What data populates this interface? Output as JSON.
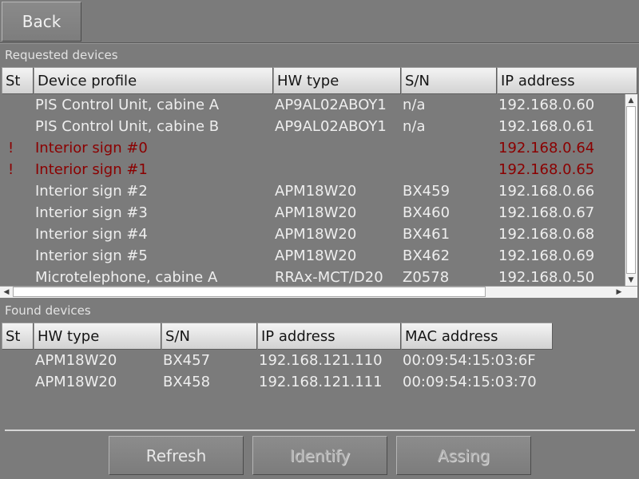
{
  "back_label": "Back",
  "requested": {
    "label": "Requested devices",
    "columns": [
      "St",
      "Device profile",
      "HW type",
      "S/N",
      "IP address"
    ],
    "rows": [
      {
        "st": "",
        "profile": "PIS Control Unit, cabine A",
        "hw": "AP9AL02ABOY1",
        "sn": "n/a",
        "ip": "192.168.0.60"
      },
      {
        "st": "",
        "profile": "PIS Control Unit, cabine B",
        "hw": "AP9AL02ABOY1",
        "sn": "n/a",
        "ip": "192.168.0.61"
      },
      {
        "st": "!",
        "profile": "Interior sign #0",
        "hw": "",
        "sn": "",
        "ip": "192.168.0.64"
      },
      {
        "st": "!",
        "profile": "Interior sign #1",
        "hw": "",
        "sn": "",
        "ip": "192.168.0.65"
      },
      {
        "st": "",
        "profile": "Interior sign #2",
        "hw": "APM18W20",
        "sn": "BX459",
        "ip": "192.168.0.66"
      },
      {
        "st": "",
        "profile": "Interior sign #3",
        "hw": "APM18W20",
        "sn": "BX460",
        "ip": "192.168.0.67"
      },
      {
        "st": "",
        "profile": "Interior sign #4",
        "hw": "APM18W20",
        "sn": "BX461",
        "ip": "192.168.0.68"
      },
      {
        "st": "",
        "profile": "Interior sign #5",
        "hw": "APM18W20",
        "sn": "BX462",
        "ip": "192.168.0.69"
      },
      {
        "st": "",
        "profile": "Microtelephone, cabine A",
        "hw": "RRAx-MCT/D20",
        "sn": "Z0578",
        "ip": "192.168.0.50"
      }
    ]
  },
  "found": {
    "label": "Found devices",
    "columns": [
      "St",
      "HW type",
      "S/N",
      "IP address",
      "MAC address"
    ],
    "rows": [
      {
        "st": "",
        "hw": "APM18W20",
        "sn": "BX457",
        "ip": "192.168.121.110",
        "mac": "00:09:54:15:03:6F"
      },
      {
        "st": "",
        "hw": "APM18W20",
        "sn": "BX458",
        "ip": "192.168.121.111",
        "mac": "00:09:54:15:03:70"
      }
    ]
  },
  "actions": {
    "refresh": "Refresh",
    "identify": "Identify",
    "assign": "Assing"
  },
  "icons": {
    "scroll_up": "up-arrow",
    "scroll_down": "down-arrow",
    "scroll_left": "left-arrow",
    "scroll_right": "right-arrow"
  },
  "colors": {
    "error_text": "#8b0000",
    "background": "#7b7b7b"
  }
}
